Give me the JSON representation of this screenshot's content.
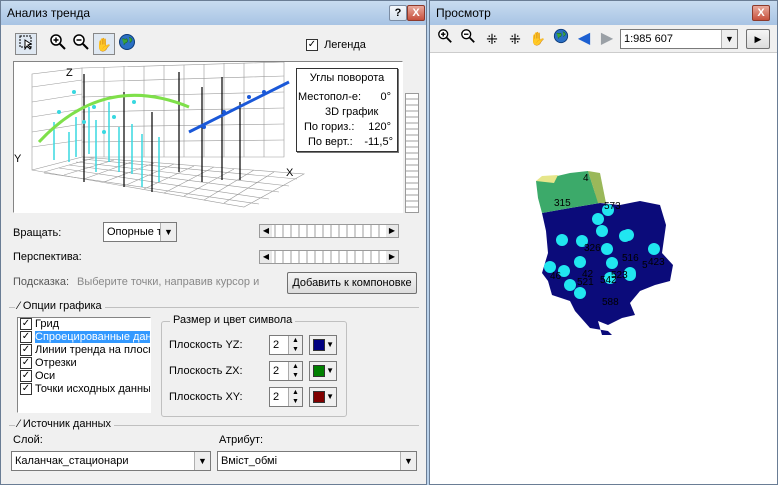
{
  "trend": {
    "title": "Анализ тренда",
    "help_label": "?",
    "close_label": "X",
    "legend_label": "Легенда",
    "rotation_box": {
      "title": "Углы поворота",
      "position_label": "Местопол-е:",
      "position_value": "0°",
      "graph_label": "3D график",
      "horizontal_label": "По гориз.:",
      "horizontal_value": "120°",
      "vertical_label": "По верт.:",
      "vertical_value": "-11,5°"
    },
    "axis_x": "X",
    "axis_y": "Y",
    "axis_z": "Z",
    "rotate_label": "Вращать:",
    "rotate_value": "Опорные т",
    "perspective_label": "Перспектива:",
    "hint_label": "Подсказка:",
    "hint_text": "Выберите точки, направив курсор и",
    "add_layout_button": "Добавить к компоновке",
    "graph_options_title": "Опции графика",
    "options": [
      {
        "label": "Грид",
        "checked": true
      },
      {
        "label": "Спроецированные дан",
        "checked": true
      },
      {
        "label": "Линии тренда на плоск",
        "checked": true
      },
      {
        "label": "Отрезки",
        "checked": true
      },
      {
        "label": "Оси",
        "checked": true
      },
      {
        "label": "Точки исходных данны",
        "checked": true
      }
    ],
    "symbol_group_title": "Размер и цвет символа",
    "planes": [
      {
        "label": "Плоскость YZ:",
        "size": "2",
        "color": "#000080"
      },
      {
        "label": "Плоскость ZX:",
        "size": "2",
        "color": "#008000"
      },
      {
        "label": "Плоскость XY:",
        "size": "2",
        "color": "#800000"
      }
    ],
    "data_source_title": "Источник данных",
    "layer_label": "Слой:",
    "layer_value": "Каланчак_стационари",
    "attribute_label": "Атрибут:",
    "attribute_value": "Вміст_обмі"
  },
  "preview": {
    "title": "Просмотр",
    "close_label": "X",
    "scale_value": "1:985 607",
    "map_labels": [
      "315",
      "573",
      "4",
      "423",
      "326",
      "523",
      "516",
      "5",
      "46",
      "42",
      "521",
      "542",
      "588"
    ]
  }
}
